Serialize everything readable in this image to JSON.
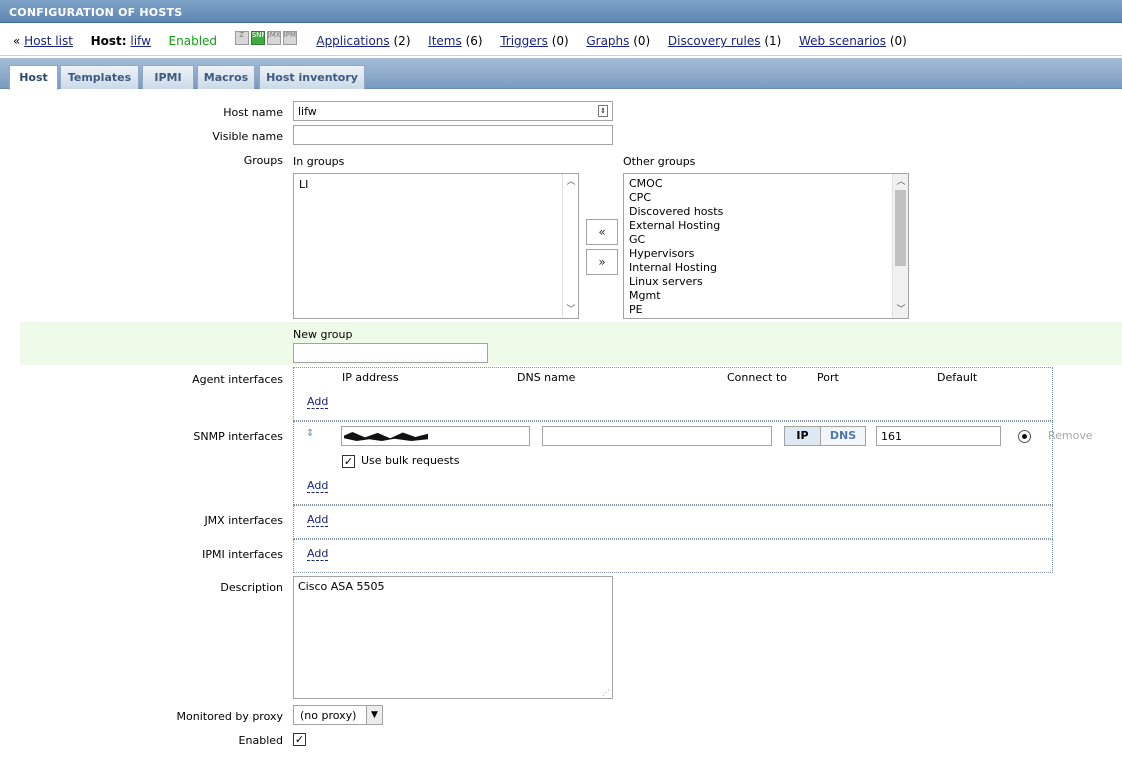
{
  "window": {
    "title": "CONFIGURATION OF HOSTS"
  },
  "nav": {
    "back_prefix": "«",
    "host_list": "Host list",
    "host_label": "Host:",
    "host_name": "lifw",
    "status": "Enabled",
    "availability": [
      "Z",
      "SNMP",
      "JMX",
      "IPMI"
    ],
    "links": [
      {
        "label": "Applications",
        "count": "(2)"
      },
      {
        "label": "Items",
        "count": "(6)"
      },
      {
        "label": "Triggers",
        "count": "(0)"
      },
      {
        "label": "Graphs",
        "count": "(0)"
      },
      {
        "label": "Discovery rules",
        "count": "(1)"
      },
      {
        "label": "Web scenarios",
        "count": "(0)"
      }
    ]
  },
  "tabs": [
    "Host",
    "Templates",
    "IPMI",
    "Macros",
    "Host inventory"
  ],
  "form": {
    "host_name": {
      "label": "Host name",
      "value": "lifw"
    },
    "visible_name": {
      "label": "Visible name",
      "value": ""
    },
    "groups": {
      "label": "Groups",
      "in_label": "In groups",
      "in_groups": [
        "LI"
      ],
      "other_label": "Other groups",
      "other_groups": [
        "CMOC",
        "CPC",
        "Discovered hosts",
        "External Hosting",
        "GC",
        "Hypervisors",
        "Internal Hosting",
        "Linux servers",
        "Mgmt",
        "PE"
      ],
      "add_btn": "«",
      "remove_btn": "»"
    },
    "new_group": {
      "label": "New group",
      "value": ""
    },
    "agent": {
      "label": "Agent interfaces",
      "headers": {
        "ip": "IP address",
        "dns": "DNS name",
        "connect": "Connect to",
        "port": "Port",
        "default": "Default"
      },
      "add": "Add"
    },
    "snmp": {
      "label": "SNMP interfaces",
      "dns_value": "",
      "connect_ip": "IP",
      "connect_dns": "DNS",
      "port": "161",
      "remove": "Remove",
      "bulk_label": "Use bulk requests",
      "add": "Add"
    },
    "jmx": {
      "label": "JMX interfaces",
      "add": "Add"
    },
    "ipmi": {
      "label": "IPMI interfaces",
      "add": "Add"
    },
    "description": {
      "label": "Description",
      "value": "Cisco ASA 5505"
    },
    "proxy": {
      "label": "Monitored by proxy",
      "value": "(no proxy)"
    },
    "enabled": {
      "label": "Enabled"
    }
  },
  "colors": {
    "header": "#5f87b3",
    "enabled_text": "#12a012",
    "link": "#1a237e",
    "new_group_band": "#effbe9"
  }
}
